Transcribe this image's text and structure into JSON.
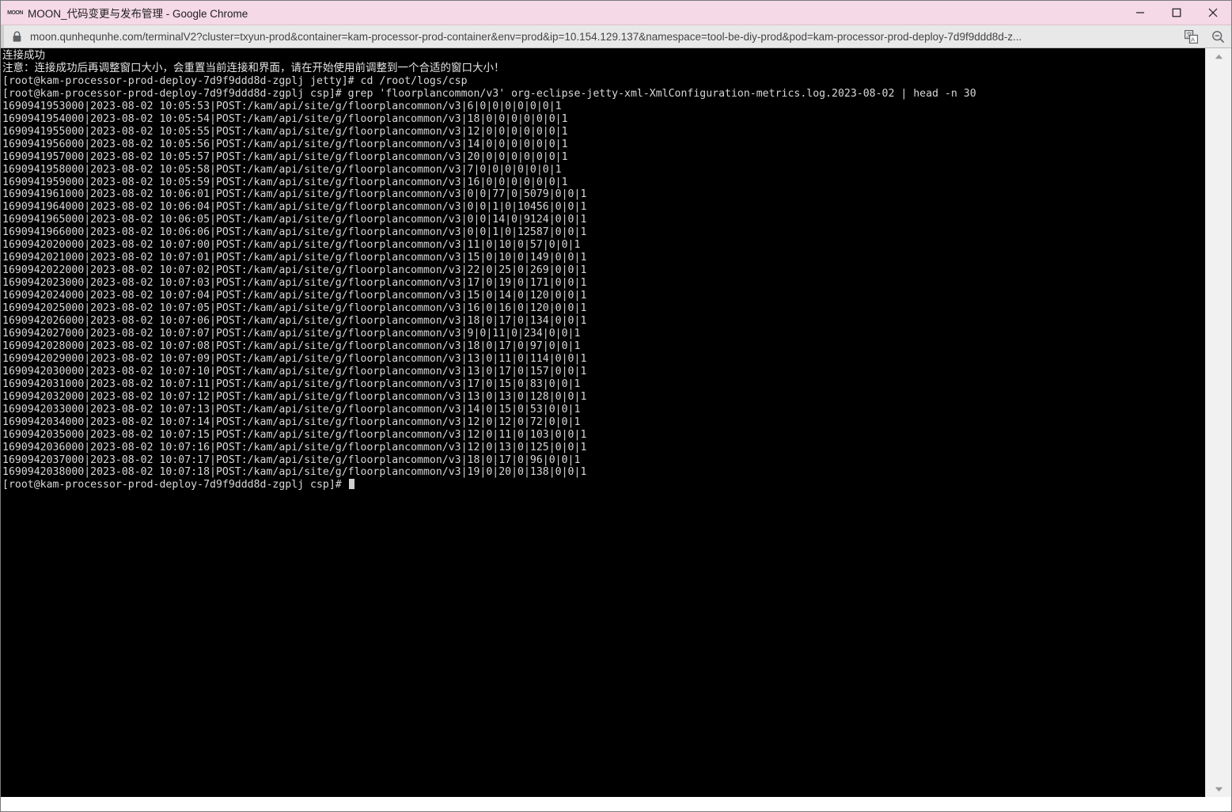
{
  "window": {
    "title": "MOON_代码变更与发布管理 - Google Chrome",
    "favicon_label": "MOON",
    "titlebar_color": "#f5d9e6",
    "controls": {
      "minimize": "minimize-button",
      "maximize": "maximize-button",
      "close": "close-button"
    }
  },
  "toolbar": {
    "lock_icon": "lock-icon",
    "url": "moon.qunhequnhe.com/terminalV2?cluster=txyun-prod&container=kam-processor-prod-container&env=prod&ip=10.154.129.137&namespace=tool-be-diy-prod&pod=kam-processor-prod-deploy-7d9f9ddd8d-z...",
    "translate_icon": "translate-icon",
    "zoom_icon": "zoom-out-icon"
  },
  "terminal": {
    "background": "#000000",
    "foreground": "#d8d8d8",
    "banner": [
      "连接成功",
      "注意：连接成功后再调整窗口大小，会重置当前连接和界面，请在开始使用前调整到一个合适的窗口大小！"
    ],
    "prompt_1": "[root@kam-processor-prod-deploy-7d9f9ddd8d-zgplj jetty]# cd /root/logs/csp",
    "prompt_2": "[root@kam-processor-prod-deploy-7d9f9ddd8d-zgplj csp]# grep 'floorplancommon/v3' org-eclipse-jetty-xml-XmlConfiguration-metrics.log.2023-08-02 | head -n 30",
    "log_lines": [
      "1690941953000|2023-08-02 10:05:53|POST:/kam/api/site/g/floorplancommon/v3|6|0|0|0|0|0|0|1",
      "1690941954000|2023-08-02 10:05:54|POST:/kam/api/site/g/floorplancommon/v3|18|0|0|0|0|0|0|1",
      "1690941955000|2023-08-02 10:05:55|POST:/kam/api/site/g/floorplancommon/v3|12|0|0|0|0|0|0|1",
      "1690941956000|2023-08-02 10:05:56|POST:/kam/api/site/g/floorplancommon/v3|14|0|0|0|0|0|0|1",
      "1690941957000|2023-08-02 10:05:57|POST:/kam/api/site/g/floorplancommon/v3|20|0|0|0|0|0|0|1",
      "1690941958000|2023-08-02 10:05:58|POST:/kam/api/site/g/floorplancommon/v3|7|0|0|0|0|0|0|1",
      "1690941959000|2023-08-02 10:05:59|POST:/kam/api/site/g/floorplancommon/v3|16|0|0|0|0|0|0|1",
      "1690941961000|2023-08-02 10:06:01|POST:/kam/api/site/g/floorplancommon/v3|0|0|77|0|5079|0|0|1",
      "1690941964000|2023-08-02 10:06:04|POST:/kam/api/site/g/floorplancommon/v3|0|0|1|0|10456|0|0|1",
      "1690941965000|2023-08-02 10:06:05|POST:/kam/api/site/g/floorplancommon/v3|0|0|14|0|9124|0|0|1",
      "1690941966000|2023-08-02 10:06:06|POST:/kam/api/site/g/floorplancommon/v3|0|0|1|0|12587|0|0|1",
      "1690942020000|2023-08-02 10:07:00|POST:/kam/api/site/g/floorplancommon/v3|11|0|10|0|57|0|0|1",
      "1690942021000|2023-08-02 10:07:01|POST:/kam/api/site/g/floorplancommon/v3|15|0|10|0|149|0|0|1",
      "1690942022000|2023-08-02 10:07:02|POST:/kam/api/site/g/floorplancommon/v3|22|0|25|0|269|0|0|1",
      "1690942023000|2023-08-02 10:07:03|POST:/kam/api/site/g/floorplancommon/v3|17|0|19|0|171|0|0|1",
      "1690942024000|2023-08-02 10:07:04|POST:/kam/api/site/g/floorplancommon/v3|15|0|14|0|120|0|0|1",
      "1690942025000|2023-08-02 10:07:05|POST:/kam/api/site/g/floorplancommon/v3|16|0|16|0|120|0|0|1",
      "1690942026000|2023-08-02 10:07:06|POST:/kam/api/site/g/floorplancommon/v3|18|0|17|0|134|0|0|1",
      "1690942027000|2023-08-02 10:07:07|POST:/kam/api/site/g/floorplancommon/v3|9|0|11|0|234|0|0|1",
      "1690942028000|2023-08-02 10:07:08|POST:/kam/api/site/g/floorplancommon/v3|18|0|17|0|97|0|0|1",
      "1690942029000|2023-08-02 10:07:09|POST:/kam/api/site/g/floorplancommon/v3|13|0|11|0|114|0|0|1",
      "1690942030000|2023-08-02 10:07:10|POST:/kam/api/site/g/floorplancommon/v3|13|0|17|0|157|0|0|1",
      "1690942031000|2023-08-02 10:07:11|POST:/kam/api/site/g/floorplancommon/v3|17|0|15|0|83|0|0|1",
      "1690942032000|2023-08-02 10:07:12|POST:/kam/api/site/g/floorplancommon/v3|13|0|13|0|128|0|0|1",
      "1690942033000|2023-08-02 10:07:13|POST:/kam/api/site/g/floorplancommon/v3|14|0|15|0|53|0|0|1",
      "1690942034000|2023-08-02 10:07:14|POST:/kam/api/site/g/floorplancommon/v3|12|0|12|0|72|0|0|1",
      "1690942035000|2023-08-02 10:07:15|POST:/kam/api/site/g/floorplancommon/v3|12|0|11|0|103|0|0|1",
      "1690942036000|2023-08-02 10:07:16|POST:/kam/api/site/g/floorplancommon/v3|12|0|13|0|125|0|0|1",
      "1690942037000|2023-08-02 10:07:17|POST:/kam/api/site/g/floorplancommon/v3|18|0|17|0|96|0|0|1",
      "1690942038000|2023-08-02 10:07:18|POST:/kam/api/site/g/floorplancommon/v3|19|0|20|0|138|0|0|1"
    ],
    "prompt_3": "[root@kam-processor-prod-deploy-7d9f9ddd8d-zgplj csp]# "
  },
  "scrollbar": {
    "up_arrow": "scroll-up-arrow",
    "down_arrow": "scroll-down-arrow"
  }
}
